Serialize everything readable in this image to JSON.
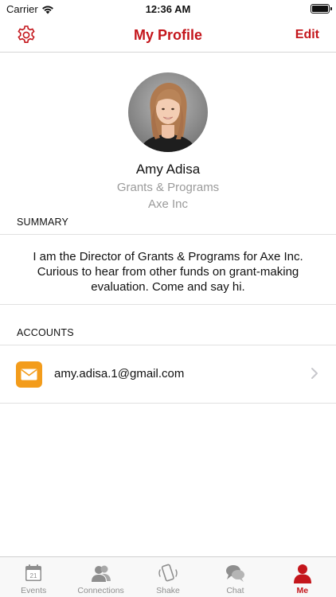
{
  "status_bar": {
    "carrier": "Carrier",
    "time": "12:36 AM"
  },
  "nav": {
    "title": "My Profile",
    "edit_label": "Edit",
    "settings_icon": "gear-icon"
  },
  "profile": {
    "name": "Amy Adisa",
    "department": "Grants & Programs",
    "company": "Axe Inc"
  },
  "summary": {
    "header": "SUMMARY",
    "text": "I am the Director of Grants & Programs for Axe Inc. Curious to hear from other funds on grant-making evaluation. Come and say hi."
  },
  "accounts": {
    "header": "ACCOUNTS",
    "items": [
      {
        "email": "amy.adisa.1@gmail.com",
        "icon": "mail-icon"
      }
    ]
  },
  "tab_bar": {
    "tabs": [
      {
        "label": "Events",
        "icon": "calendar-icon",
        "calendar_day": "21"
      },
      {
        "label": "Connections",
        "icon": "people-icon"
      },
      {
        "label": "Shake",
        "icon": "shake-phone-icon"
      },
      {
        "label": "Chat",
        "icon": "chat-bubbles-icon"
      },
      {
        "label": "Me",
        "icon": "person-icon",
        "active": true
      }
    ]
  },
  "colors": {
    "accent": "#c4161c",
    "mail_icon_bg": "#f39c1b",
    "secondary_text": "#9a9a9a",
    "inactive_tab": "#8e8e8e"
  }
}
